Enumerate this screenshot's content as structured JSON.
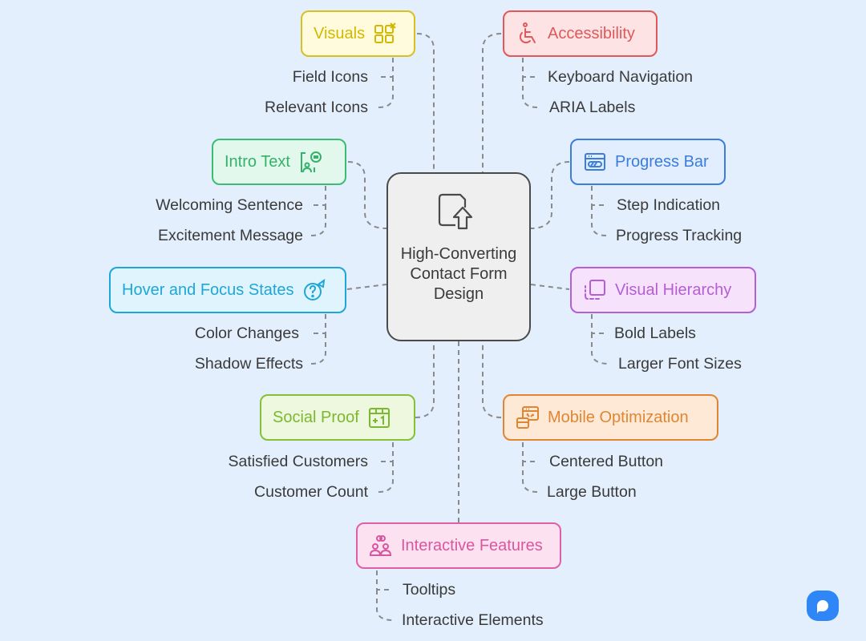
{
  "diagram": {
    "central": {
      "title": "High-Converting Contact Form Design",
      "icon": "document-upload-icon"
    },
    "branches": [
      {
        "id": "visuals",
        "label": "Visuals",
        "icon": "grid-edit-icon",
        "color": "#d4b800",
        "fill": "#fffbdc",
        "children": [
          "Field Icons",
          "Relevant Icons"
        ]
      },
      {
        "id": "accessibility",
        "label": "Accessibility",
        "icon": "wheelchair-icon",
        "color": "#e0585a",
        "fill": "#fde3e3",
        "children": [
          "Keyboard Navigation",
          "ARIA Labels"
        ]
      },
      {
        "id": "intro-text",
        "label": "Intro Text",
        "icon": "greeting-person-icon",
        "color": "#34b26a",
        "fill": "#e3f8ec",
        "children": [
          "Welcoming Sentence",
          "Excitement Message"
        ]
      },
      {
        "id": "progress-bar",
        "label": "Progress Bar",
        "icon": "browser-progress-icon",
        "color": "#3b7ddd",
        "fill": "#e2edfd",
        "children": [
          "Step Indication",
          "Progress Tracking"
        ]
      },
      {
        "id": "hover-focus",
        "label": "Hover and Focus States",
        "icon": "question-cursor-icon",
        "color": "#1ea6d8",
        "fill": "#e0f4fd",
        "children": [
          "Color Changes",
          "Shadow Effects"
        ]
      },
      {
        "id": "visual-hierarchy",
        "label": "Visual Hierarchy",
        "icon": "layered-square-icon",
        "color": "#b45ed6",
        "fill": "#f7e2fb",
        "children": [
          "Bold Labels",
          "Larger Font Sizes"
        ]
      },
      {
        "id": "social-proof",
        "label": "Social Proof",
        "icon": "calendar-plus-one-icon",
        "color": "#7cb82f",
        "fill": "#eef8df",
        "children": [
          "Satisfied Customers",
          "Customer Count"
        ]
      },
      {
        "id": "mobile-optimization",
        "label": "Mobile Optimization",
        "icon": "responsive-window-icon",
        "color": "#e08632",
        "fill": "#fde9d6",
        "children": [
          "Centered Button",
          "Large Button"
        ]
      },
      {
        "id": "interactive-features",
        "label": "Interactive Features",
        "icon": "people-link-icon",
        "color": "#d9569f",
        "fill": "#fce2f0",
        "children": [
          "Tooltips",
          "Interactive Elements"
        ]
      }
    ]
  },
  "branding": {
    "logo": "napkin-logo-icon",
    "color": "#2f86f6"
  }
}
